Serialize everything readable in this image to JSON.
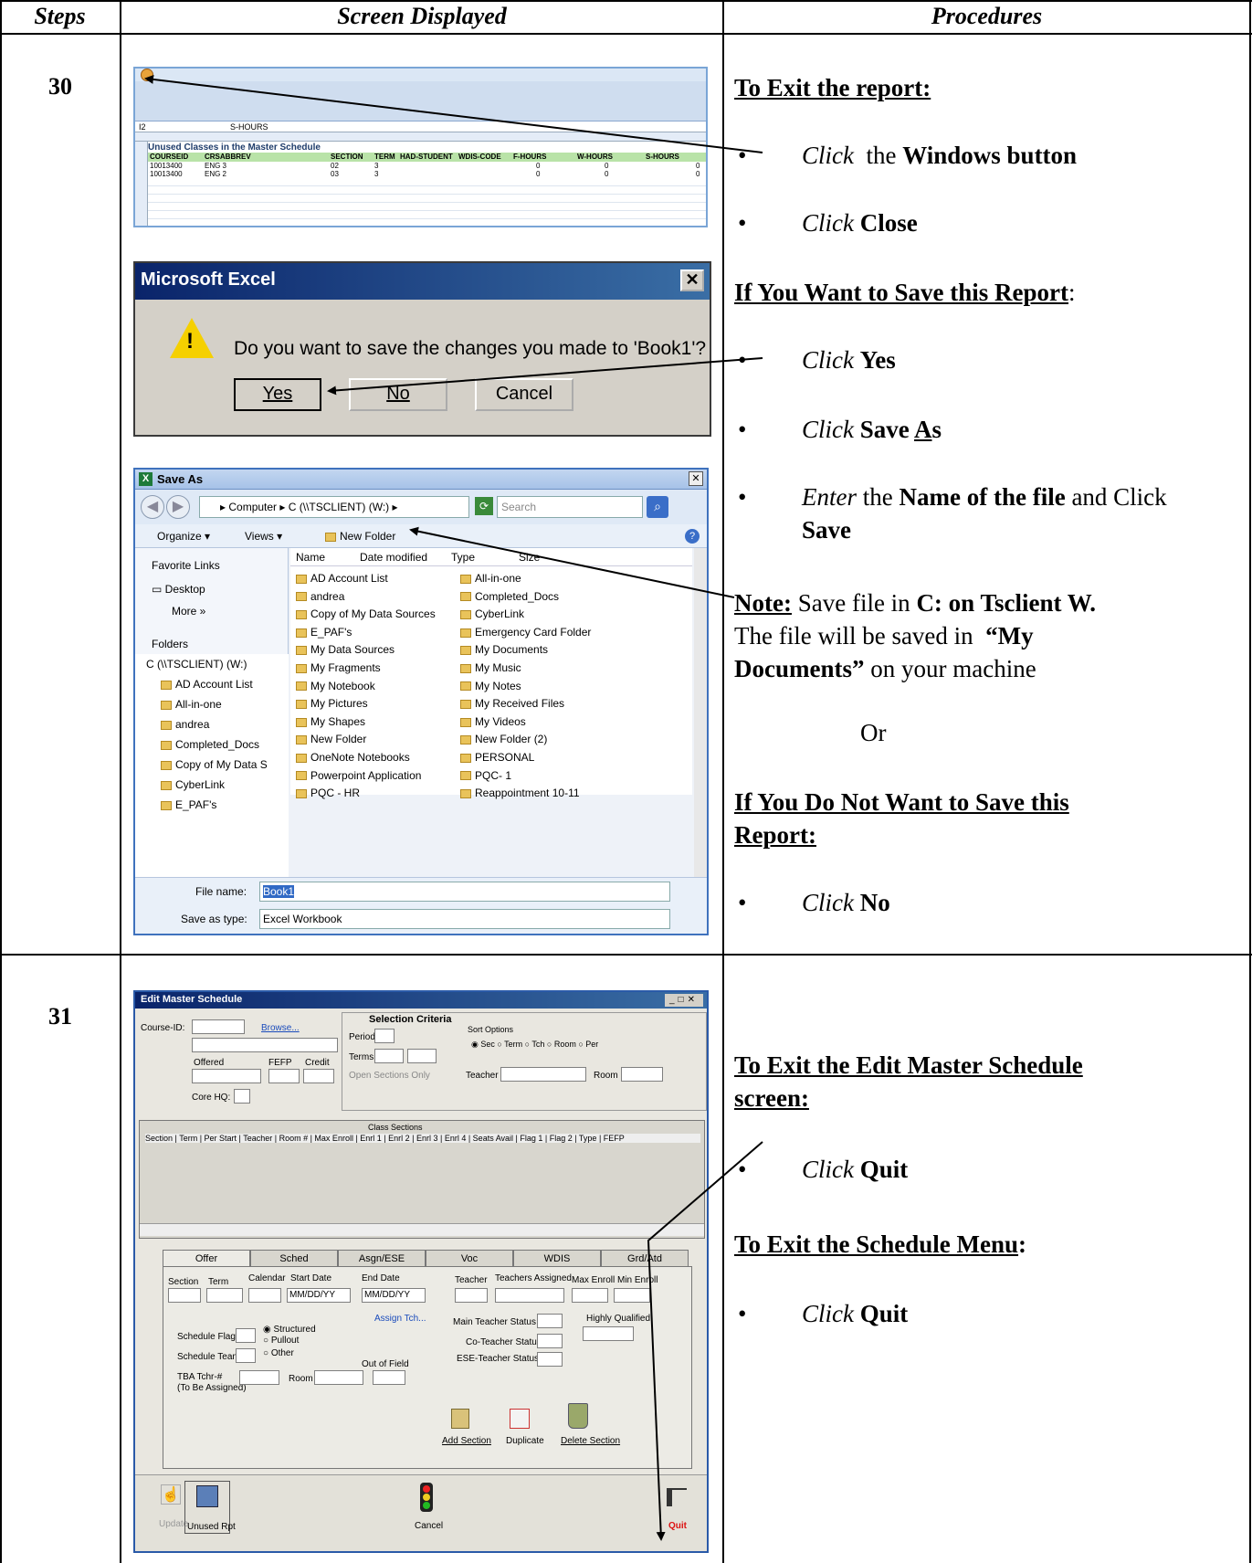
{
  "header": {
    "steps": "Steps",
    "screen": "Screen Displayed",
    "procedures": "Procedures"
  },
  "step30": {
    "number": "30",
    "excel": {
      "sheet_title": "Unused Classes in the Master Schedule",
      "name_box": "I2",
      "formula": "S-HOURS",
      "columns": [
        "COURSEID",
        "CRSABBREV",
        "SECTION",
        "TERM",
        "HAD-STUDENT",
        "WDIS-CODE",
        "F-HOURS",
        "W-HOURS",
        "S-HOURS"
      ],
      "rows": [
        [
          "10013400",
          "ENG 3",
          "02",
          "3",
          "",
          "",
          "0",
          "0",
          "0"
        ],
        [
          "10013400",
          "ENG 2",
          "03",
          "3",
          "",
          "",
          "0",
          "0",
          "0"
        ]
      ]
    },
    "dialog": {
      "title": "Microsoft Excel",
      "message": "Do you want to save the changes you made to 'Book1'?",
      "yes": "Yes",
      "no": "No",
      "cancel": "Cancel"
    },
    "saveas": {
      "title": "Save As",
      "path": "▸ Computer ▸ C (\\\\TSCLIENT) (W:) ▸",
      "search": "Search",
      "organize": "Organize ▾",
      "views": "Views ▾",
      "new_folder": "New Folder",
      "favorite_links": "Favorite Links",
      "desktop": "Desktop",
      "more": "More »",
      "folders": "Folders",
      "col_name": "Name",
      "col_date": "Date modified",
      "col_type": "Type",
      "col_size": "Size",
      "tree": [
        "C (\\\\TSCLIENT) (W:)",
        "AD Account List",
        "All-in-one",
        "andrea",
        "Completed_Docs",
        "Copy of My Data S",
        "CyberLink",
        "E_PAF's"
      ],
      "files_left": [
        "AD Account List",
        "andrea",
        "Copy of My Data Sources",
        "E_PAF's",
        "My Data Sources",
        "My Fragments",
        "My Notebook",
        "My Pictures",
        "My Shapes",
        "New Folder",
        "OneNote Notebooks",
        "Powerpoint Application",
        "PQC - HR"
      ],
      "files_right": [
        "All-in-one",
        "Completed_Docs",
        "CyberLink",
        "Emergency Card Folder",
        "My Documents",
        "My Music",
        "My Notes",
        "My Received Files",
        "My Videos",
        "New Folder (2)",
        "PERSONAL",
        "PQC- 1",
        "Reappointment 10-11"
      ],
      "file_name_label": "File name:",
      "file_name": "Book1",
      "save_type_label": "Save as type:",
      "save_type": "Excel Workbook"
    },
    "proc": {
      "exit_report": "To Exit the report:",
      "b1_a": "Click",
      "b1_b": "the",
      "b1_c": "Windows button",
      "b2_a": "Click",
      "b2_b": "Close",
      "save_heading": "If You Want to Save this Report",
      "colon": ":",
      "b3_a": "Click",
      "b3_b": "Yes",
      "b4_a": "Click",
      "b4_b": "Save ",
      "b4_c": "A",
      "b4_d": "s",
      "b5_a": "Enter",
      "b5_b": "the",
      "b5_c": "Name of the file",
      "b5_d": "and Click",
      "b5_e": "Save",
      "note_label": "Note:",
      "note_1": "Save file in",
      "note_2": "C: on Tsclient W.",
      "note_3": "The file will be saved in",
      "note_4": "“My",
      "note_5": "Documents”",
      "note_6": "on your machine",
      "or": "Or",
      "nosave_1": "If You Do Not Want to Save this",
      "nosave_2": "Report:",
      "b6_a": "Click",
      "b6_b": "No"
    }
  },
  "step31": {
    "number": "31",
    "ems": {
      "title": "Edit Master Schedule",
      "course_id": "Course-ID:",
      "browse": "Browse...",
      "offered": "Offered",
      "fefp": "FEFP",
      "credit": "Credit",
      "core_hq": "Core HQ:",
      "selection_criteria": "Selection Criteria",
      "period": "Period",
      "terms": "Terms",
      "open_sections": "Open Sections Only",
      "sort_options": "Sort Options",
      "sort_items": "◉ Sec  ○ Term  ○ Tch  ○ Room ○ Per",
      "teacher": "Teacher",
      "room": "Room",
      "class_sections": "Class Sections",
      "grid_cols": "Section | Term | Per Start | Teacher | Room # | Max Enroll | Enrl 1 | Enrl 2 | Enrl 3 | Enrl 4 | Seats Avail | Flag 1 | Flag 2 | Type | FEFP",
      "tabs": [
        "Offer",
        "Sched",
        "Asgn/ESE",
        "Voc",
        "WDIS",
        "Grd/Atd"
      ],
      "section": "Section",
      "term": "Term",
      "calendar": "Calendar",
      "start_date": "Start Date",
      "end_date": "End Date",
      "date_ph": "MM/DD/YY",
      "teacher2": "Teacher",
      "teachers_assigned": "Teachers Assigned",
      "max_enroll": "Max Enroll",
      "min_enroll": "Min Enroll",
      "assign_tch": "Assign Tch...",
      "main_teacher_status": "Main Teacher Status",
      "highly_qualified": "Highly Qualified",
      "schedule_flag": "Schedule Flag",
      "structured": "◉ Structured",
      "pullout": "○ Pullout",
      "other": "○ Other",
      "co_teacher_status": "Co-Teacher Status",
      "schedule_team": "Schedule Team",
      "ese_teacher_status": "ESE-Teacher Status",
      "out_of_field": "Out of Field",
      "tba_1": "TBA Tchr-#",
      "tba_2": "(To Be Assigned)",
      "room2": "Room",
      "add_section": "Add Section",
      "duplicate": "Duplicate",
      "delete_section": "Delete Section",
      "update": "Update",
      "unused_rpt": "Unused Rpt",
      "cancel": "Cancel",
      "quit": "Quit"
    },
    "proc": {
      "h1_a": "To Exit the Edit Master Schedule",
      "h1_b": "screen:",
      "b1_a": "Click",
      "b1_b": "Quit",
      "h2": "To Exit the Schedule Menu",
      "colon": ":",
      "b2_a": "Click",
      "b2_b": "Quit"
    }
  },
  "colors": {
    "accent": "#0a246a",
    "excel_header": "#c6d8ef",
    "win_title": "#0a246a"
  }
}
